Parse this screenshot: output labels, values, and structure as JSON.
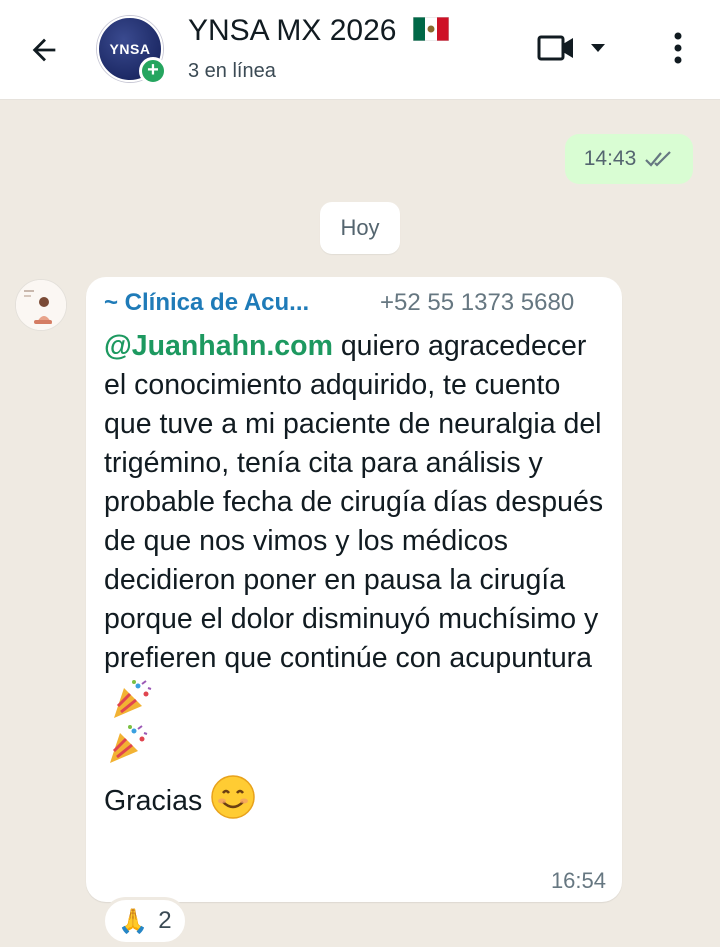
{
  "header": {
    "title": "YNSA MX 2026",
    "status": "3 en línea",
    "avatar_text": "YNSA",
    "add_badge": "+"
  },
  "outgoing": {
    "time": "14:43"
  },
  "date_chip": "Hoy",
  "message": {
    "sender_name": "~ Clínica de Acu...",
    "sender_phone": "+52 55 1373 5680",
    "mention": "@Juanhahn.com",
    "text_1": " quiero agracedecer el conocimiento adquirido, te cuento que tuve a mi paciente de neuralgia del trigémino, tenía cita para análisis y probable fecha de cirugía días después de que nos vimos y los médicos decidieron poner en pausa la cirugía porque el dolor disminuyó muchísimo y prefieren que continúe con acupuntura",
    "text_2": "Gracias",
    "time": "16:54"
  },
  "reaction": {
    "emoji": "🙏",
    "count": "2"
  },
  "colors": {
    "chat_background": "#efeae2",
    "outgoing_bubble": "#d9fdd3",
    "mention": "#1d9960",
    "sender_name": "#1f7bb8",
    "online_badge": "#25a55f"
  },
  "icons": {
    "back": "arrow-left-icon",
    "video": "video-camera-icon",
    "dropdown": "chevron-down-icon",
    "menu": "more-vertical-icon",
    "read_receipt": "double-check-icon",
    "party": "party-popper-emoji",
    "smile": "smiling-face-emoji",
    "pray": "folded-hands-emoji"
  }
}
